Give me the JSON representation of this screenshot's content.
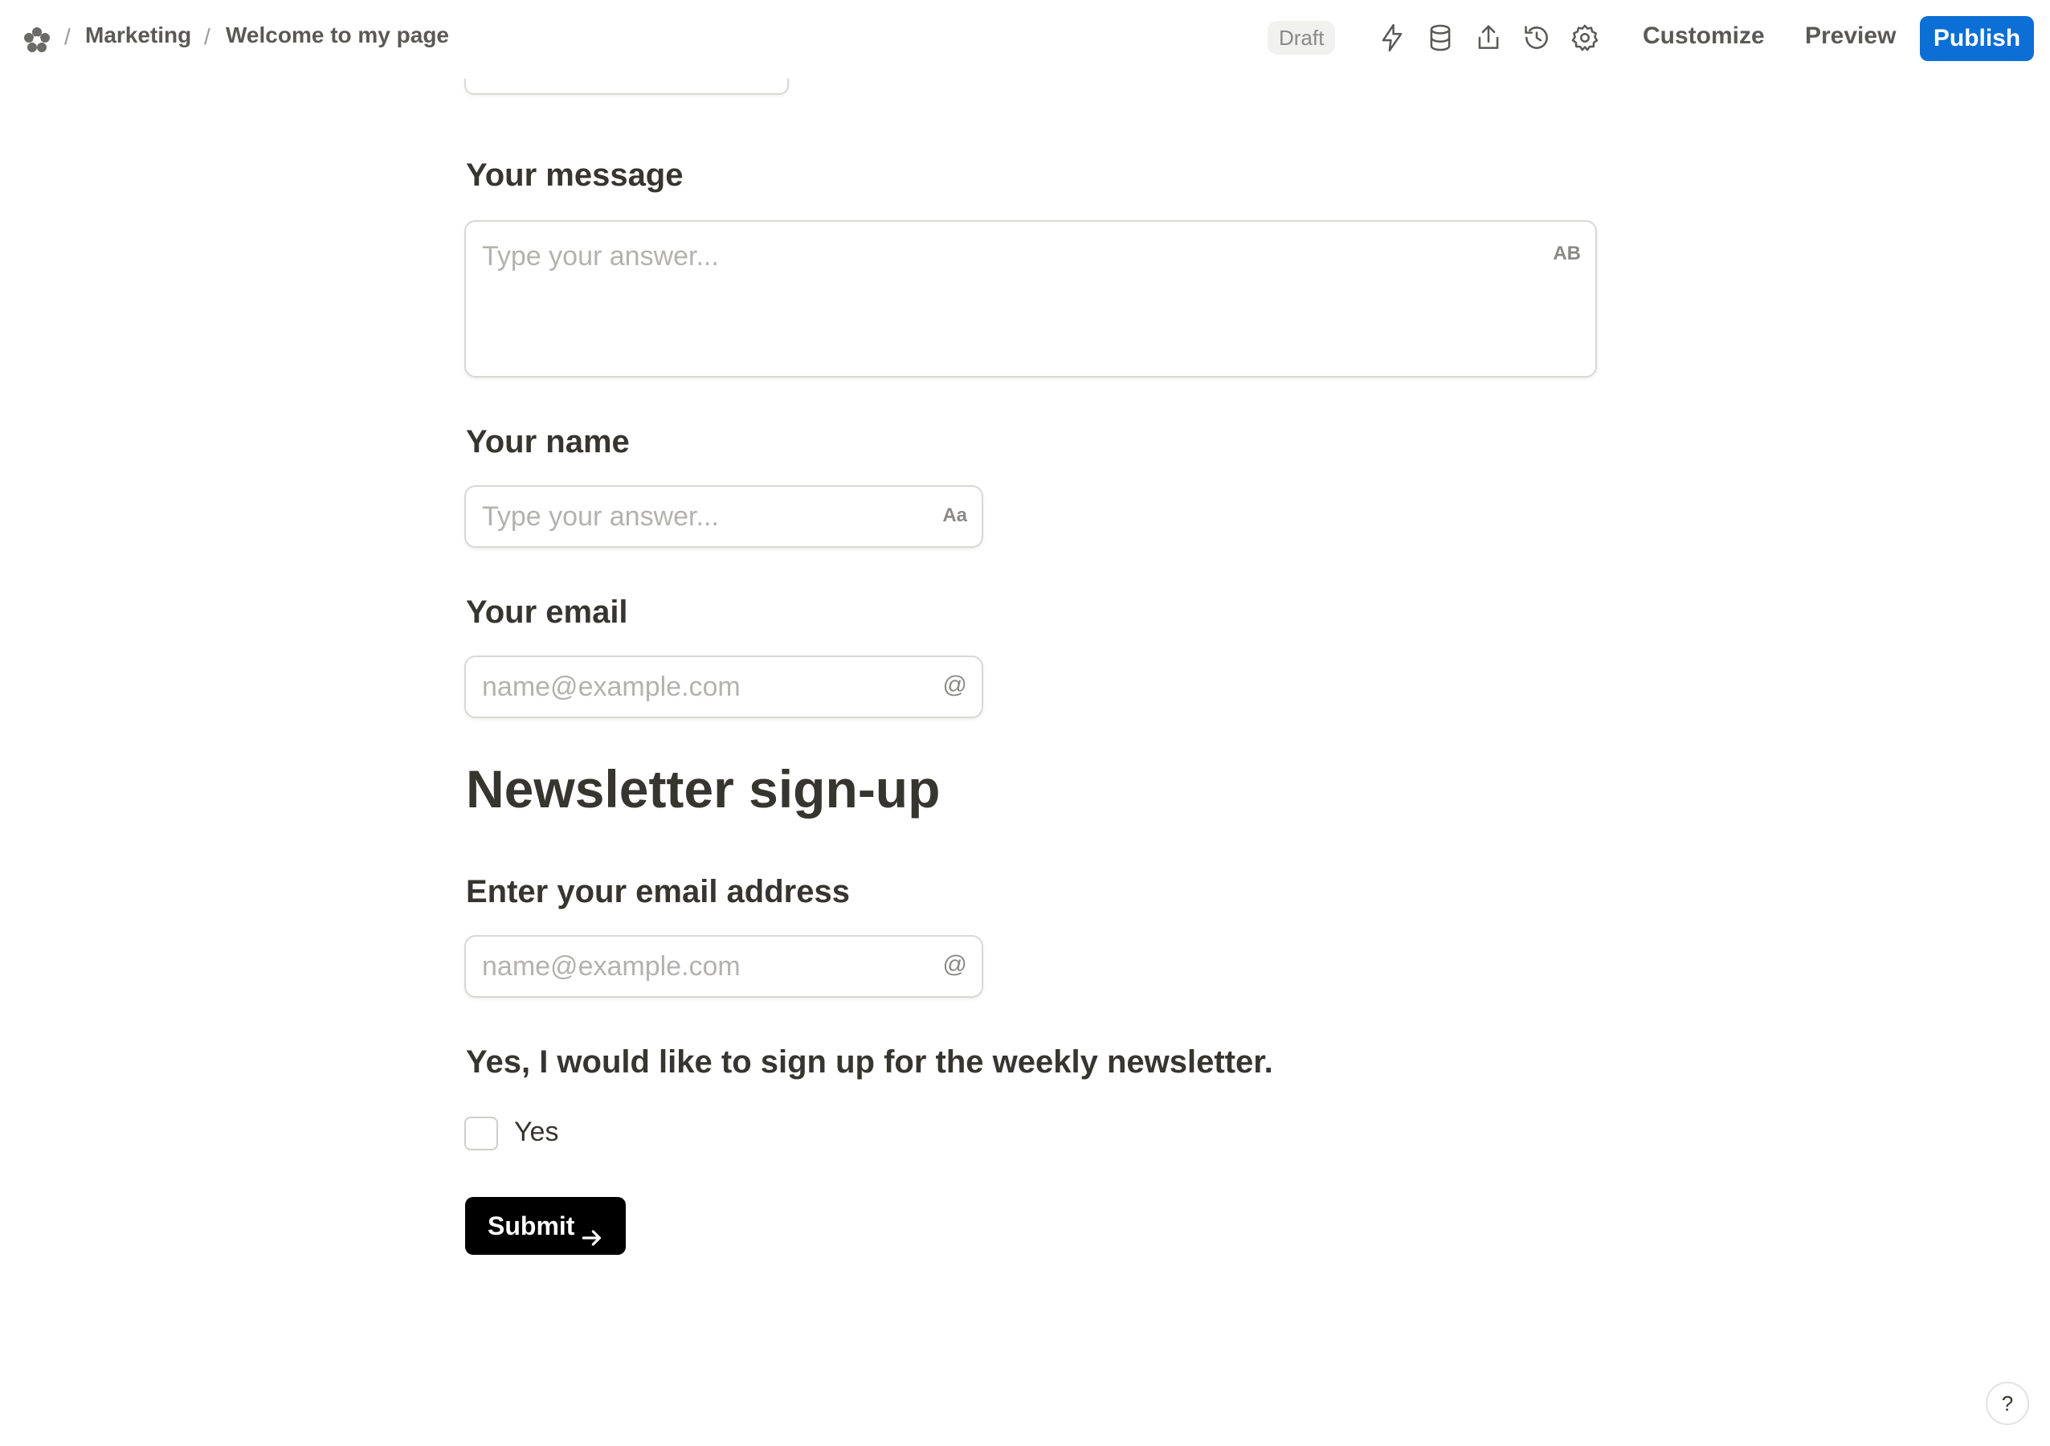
{
  "breadcrumb": {
    "separator": "/",
    "items": [
      "Marketing",
      "Welcome to my page"
    ]
  },
  "toolbar": {
    "status": "Draft",
    "icons": [
      "automation-icon",
      "database-icon",
      "share-icon",
      "history-icon",
      "settings-icon"
    ],
    "customize_label": "Customize",
    "preview_label": "Preview",
    "publish_label": "Publish",
    "accent_color": "#0b6fd6"
  },
  "form": {
    "message": {
      "label": "Your message",
      "placeholder": "Type your answer...",
      "type_badge": "AB"
    },
    "name": {
      "label": "Your name",
      "placeholder": "Type your answer...",
      "type_badge": "Aa"
    },
    "email": {
      "label": "Your email",
      "placeholder": "name@example.com",
      "type_badge": "@"
    },
    "newsletter_heading": "Newsletter sign-up",
    "newsletter_email": {
      "label": "Enter your email address",
      "placeholder": "name@example.com",
      "type_badge": "@"
    },
    "newsletter_consent": {
      "label": "Yes, I would like to sign up for the weekly newsletter.",
      "option": "Yes",
      "checked": false
    },
    "submit_label": "Submit"
  },
  "help_label": "?"
}
